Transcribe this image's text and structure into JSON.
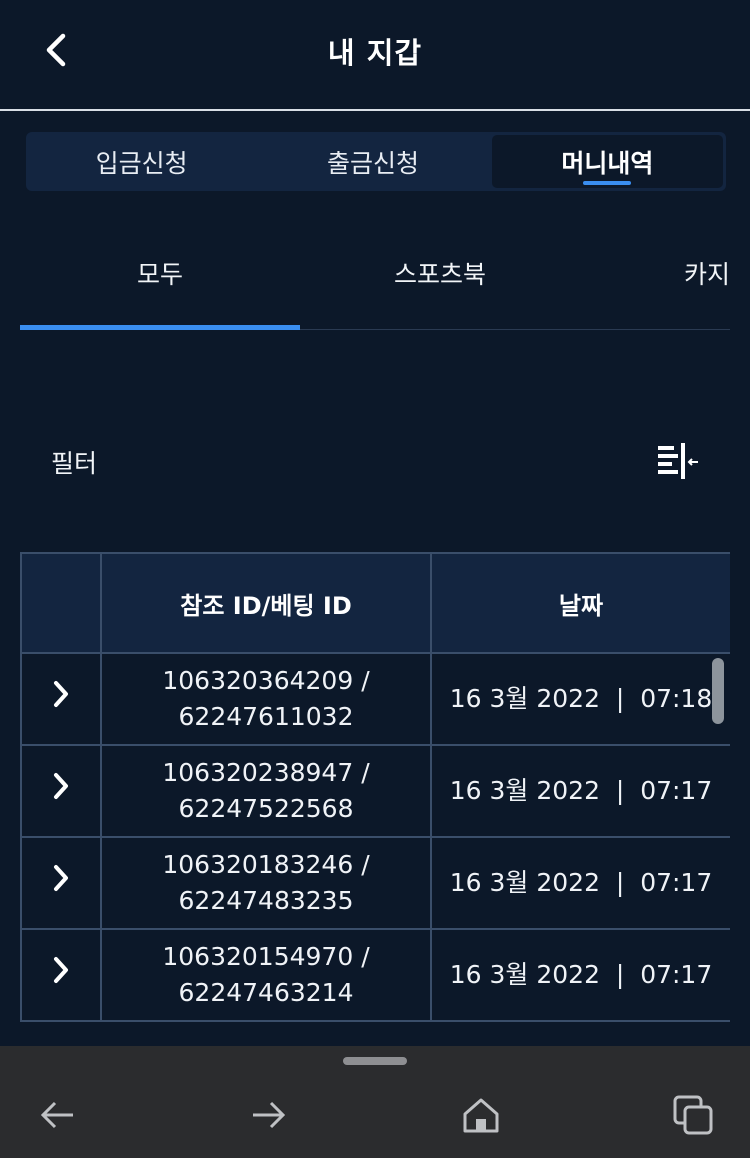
{
  "header": {
    "title": "내 지갑",
    "back_icon": "chevron-left-icon"
  },
  "segment_tabs": [
    {
      "label": "입금신청",
      "active": false
    },
    {
      "label": "출금신청",
      "active": false
    },
    {
      "label": "머니내역",
      "active": true
    }
  ],
  "sub_tabs": [
    {
      "label": "모두",
      "active": true
    },
    {
      "label": "스포츠북",
      "active": false
    },
    {
      "label": "카지",
      "active": false
    }
  ],
  "filter": {
    "label": "필터",
    "icon": "filter-collapse-icon"
  },
  "table": {
    "columns": [
      "",
      "참조 ID/베팅 ID",
      "날짜"
    ],
    "rows": [
      {
        "ref_line1": "106320364209 /",
        "ref_line2": "62247611032",
        "date": "16 3월 2022  |  07:18"
      },
      {
        "ref_line1": "106320238947 /",
        "ref_line2": "62247522568",
        "date": "16 3월 2022  |  07:17"
      },
      {
        "ref_line1": "106320183246 /",
        "ref_line2": "62247483235",
        "date": "16 3월 2022  |  07:17"
      },
      {
        "ref_line1": "106320154970 /",
        "ref_line2": "62247463214",
        "date": "16 3월 2022  |  07:17"
      }
    ]
  },
  "bottom_nav": {
    "items": [
      "back-arrow-icon",
      "forward-arrow-icon",
      "home-icon",
      "tabs-icon"
    ]
  },
  "colors": {
    "background": "#0c1829",
    "accent": "#3a8ef0",
    "panel": "#132540",
    "border": "#3a4e6a",
    "navbar": "#2b2c2e"
  }
}
